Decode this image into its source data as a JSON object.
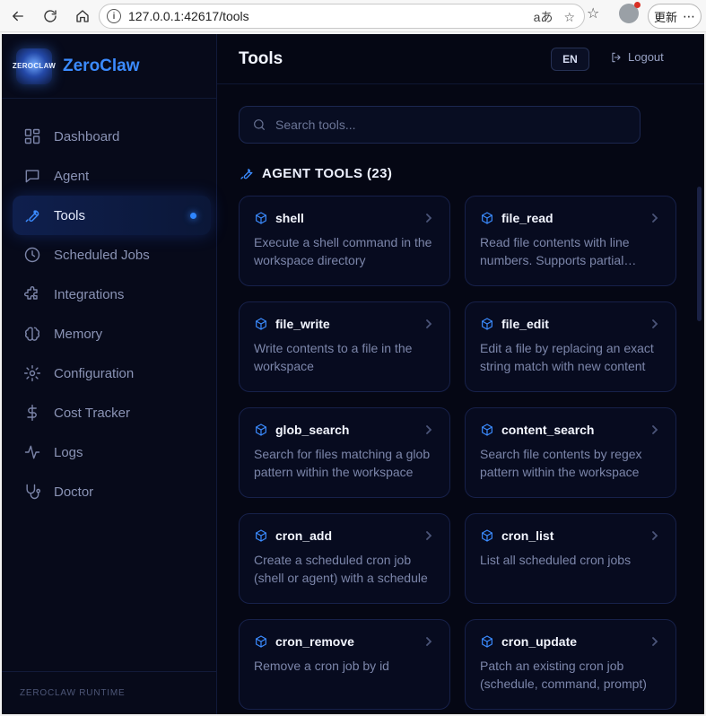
{
  "browser": {
    "url": "127.0.0.1:42617/tools",
    "update_label": "更新"
  },
  "brand": {
    "name": "ZeroClaw",
    "logo_text": "ZEROCLAW"
  },
  "sidebar": {
    "items": [
      {
        "label": "Dashboard",
        "icon": "dashboard-icon"
      },
      {
        "label": "Agent",
        "icon": "chat-icon"
      },
      {
        "label": "Tools",
        "icon": "wrench-icon",
        "active": true
      },
      {
        "label": "Scheduled Jobs",
        "icon": "clock-icon"
      },
      {
        "label": "Integrations",
        "icon": "puzzle-icon"
      },
      {
        "label": "Memory",
        "icon": "brain-icon"
      },
      {
        "label": "Configuration",
        "icon": "gear-icon"
      },
      {
        "label": "Cost Tracker",
        "icon": "dollar-icon"
      },
      {
        "label": "Logs",
        "icon": "activity-icon"
      },
      {
        "label": "Doctor",
        "icon": "stethoscope-icon"
      }
    ],
    "footer": "ZEROCLAW RUNTIME"
  },
  "header": {
    "title": "Tools",
    "lang": "EN",
    "logout": "Logout"
  },
  "search": {
    "placeholder": "Search tools..."
  },
  "section": {
    "title": "AGENT TOOLS (23)"
  },
  "tools": [
    {
      "name": "shell",
      "desc": "Execute a shell command in the workspace directory"
    },
    {
      "name": "file_read",
      "desc": "Read file contents with line numbers. Supports partial reading"
    },
    {
      "name": "file_write",
      "desc": "Write contents to a file in the workspace"
    },
    {
      "name": "file_edit",
      "desc": "Edit a file by replacing an exact string match with new content"
    },
    {
      "name": "glob_search",
      "desc": "Search for files matching a glob pattern within the workspace"
    },
    {
      "name": "content_search",
      "desc": "Search file contents by regex pattern within the workspace"
    },
    {
      "name": "cron_add",
      "desc": "Create a scheduled cron job (shell or agent) with a schedule"
    },
    {
      "name": "cron_list",
      "desc": "List all scheduled cron jobs"
    },
    {
      "name": "cron_remove",
      "desc": "Remove a cron job by id"
    },
    {
      "name": "cron_update",
      "desc": "Patch an existing cron job (schedule, command, prompt)"
    }
  ],
  "colors": {
    "accent": "#3b8bff",
    "background": "#050714",
    "card": "#070b1f"
  }
}
